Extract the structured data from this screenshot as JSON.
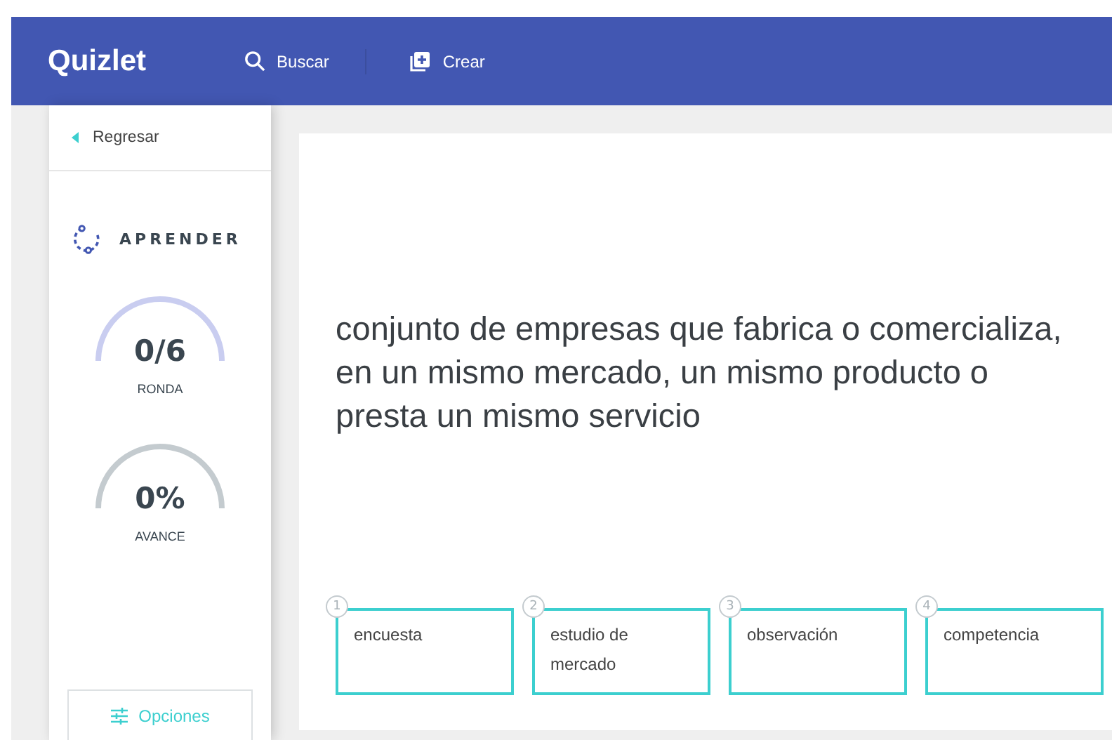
{
  "header": {
    "logo": "Quizlet",
    "nav": [
      {
        "label": "Buscar",
        "kind": "search"
      },
      {
        "label": "Crear",
        "kind": "create"
      }
    ]
  },
  "sidebar": {
    "back": "Regresar",
    "mode": "APRENDER",
    "meters": [
      {
        "value": "0/6",
        "label": "RONDA",
        "kind": "round"
      },
      {
        "value": "0%",
        "label": "AVANCE",
        "kind": "progress"
      }
    ],
    "options_button": "Opciones"
  },
  "question": {
    "prompt": "conjunto de empresas que fabrica o comercializa, en un mismo mercado, un mismo producto o presta un mismo servicio",
    "choices": [
      {
        "number": "1",
        "text": "encuesta"
      },
      {
        "number": "2",
        "text": "estudio de mercado"
      },
      {
        "number": "3",
        "text": "observación"
      },
      {
        "number": "4",
        "text": "competencia"
      }
    ]
  }
}
